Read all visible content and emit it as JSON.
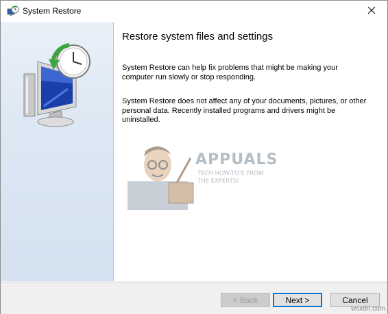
{
  "window": {
    "title": "System Restore",
    "title_icon": "system-restore-icon",
    "close_icon": "close-icon"
  },
  "left_panel": {
    "hero_icon": "computer-restore-clock-icon"
  },
  "content": {
    "heading": "Restore system files and settings",
    "paragraph_1": "System Restore can help fix problems that might be making your computer run slowly or stop responding.",
    "paragraph_2": "System Restore does not affect any of your documents, pictures, or other personal data. Recently installed programs and drivers might be uninstalled."
  },
  "watermark": {
    "brand": "APPUALS",
    "tagline": "TECH HOW-TO'S FROM THE EXPERTS!"
  },
  "footer": {
    "back_label": "< Back",
    "next_label": "Next >",
    "cancel_label": "Cancel"
  },
  "site_mark": "wsxdn.com"
}
